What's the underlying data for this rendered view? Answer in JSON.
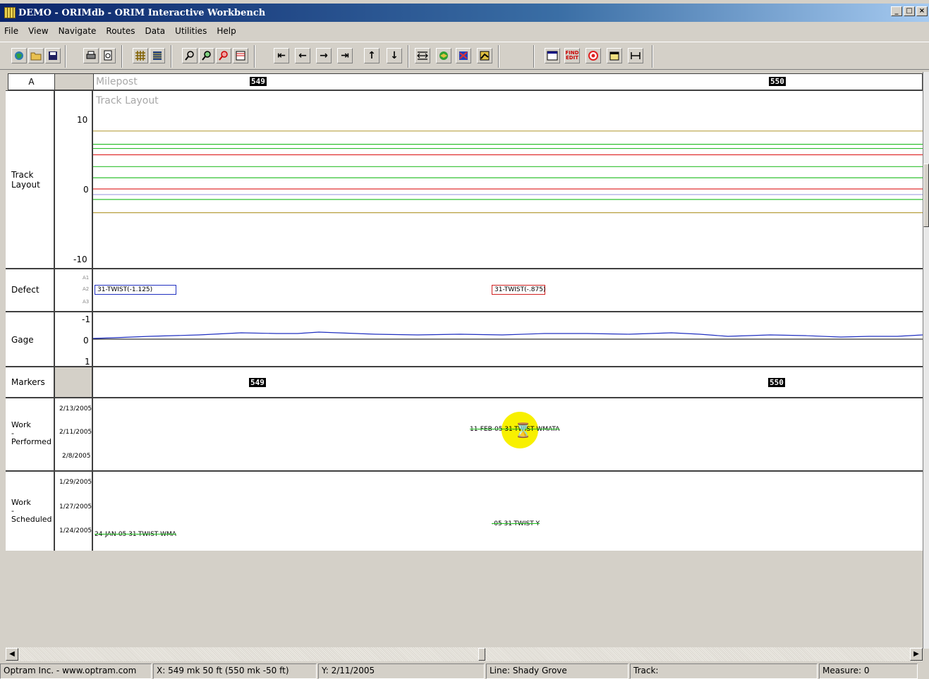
{
  "window": {
    "title": "DEMO - ORIMdb - ORIM Interactive Workbench"
  },
  "menu": [
    "File",
    "View",
    "Navigate",
    "Routes",
    "Data",
    "Utilities",
    "Help"
  ],
  "toolbar": {
    "buttons": [
      "globe-icon",
      "open-folder-icon",
      "save-icon",
      "print-icon",
      "print-preview-icon",
      "grid-icon",
      "table-icon",
      "zoom-out-icon",
      "zoom-in-icon",
      "zoom-tool-icon",
      "split-view-icon",
      "first-icon",
      "previous-icon",
      "next-icon",
      "last-icon",
      "up-icon",
      "down-icon",
      "fit-width-icon",
      "map-icon",
      "routes-icon",
      "chart-icon",
      "window-icon",
      "find-edit-icon",
      "target-icon",
      "calendar-icon",
      "measure-icon"
    ],
    "find_edit_label": "FIND EDIT"
  },
  "header": {
    "route_label": "A",
    "milepost_label": "Milepost",
    "mileposts": [
      "549",
      "550"
    ]
  },
  "track_layout": {
    "section_title": "Track Layout",
    "row_label": "Track Layout",
    "y_ticks": [
      "10",
      "0",
      "-10"
    ],
    "lines": [
      {
        "value": 8.3,
        "color": "#b8a040"
      },
      {
        "value": 6.4,
        "color": "#30c030"
      },
      {
        "value": 5.8,
        "color": "#30c030"
      },
      {
        "value": 4.9,
        "color": "#e03030"
      },
      {
        "value": 3.2,
        "color": "#30c030"
      },
      {
        "value": 1.6,
        "color": "#30c030"
      },
      {
        "value": 0.0,
        "color": "#e03030"
      },
      {
        "value": -0.8,
        "color": "#a0a0e0"
      },
      {
        "value": -1.5,
        "color": "#30c030"
      },
      {
        "value": -3.4,
        "color": "#b8a040"
      }
    ]
  },
  "defect": {
    "row_label": "Defect",
    "levels": [
      "A1",
      "A2",
      "A3"
    ],
    "items": [
      {
        "text": "31-TWIST(-1.125)",
        "color": "#2030c0"
      },
      {
        "text": "31-TWIST(-.875)",
        "color": "#d02020"
      }
    ]
  },
  "gage": {
    "row_label": "Gage",
    "y_ticks": [
      "-1",
      "0",
      "1"
    ]
  },
  "markers": {
    "row_label": "Markers",
    "mileposts": [
      "549",
      "550"
    ]
  },
  "work_performed": {
    "row_label_1": "Work",
    "row_label_2": "-",
    "row_label_3": "Performed",
    "dates": [
      "2/13/2005",
      "2/11/2005",
      "2/8/2005"
    ],
    "items": [
      {
        "text": "11-FEB-05 31-TWIST WMATA"
      }
    ]
  },
  "work_scheduled": {
    "row_label_1": "Work",
    "row_label_2": "-",
    "row_label_3": "Scheduled",
    "dates": [
      "1/29/2005",
      "1/27/2005",
      "1/24/2005"
    ],
    "items": [
      {
        "text": "24-JAN-05 31-TWIST WMA"
      },
      {
        "text": "-05 31-TWIST Y"
      }
    ]
  },
  "status": {
    "company": "Optram Inc. - www.optram.com",
    "x": "X: 549 mk 50 ft (550 mk -50 ft)",
    "y": "Y: 2/11/2005",
    "line": "Line: Shady Grove",
    "track": "Track:",
    "measure": "Measure: 0"
  }
}
